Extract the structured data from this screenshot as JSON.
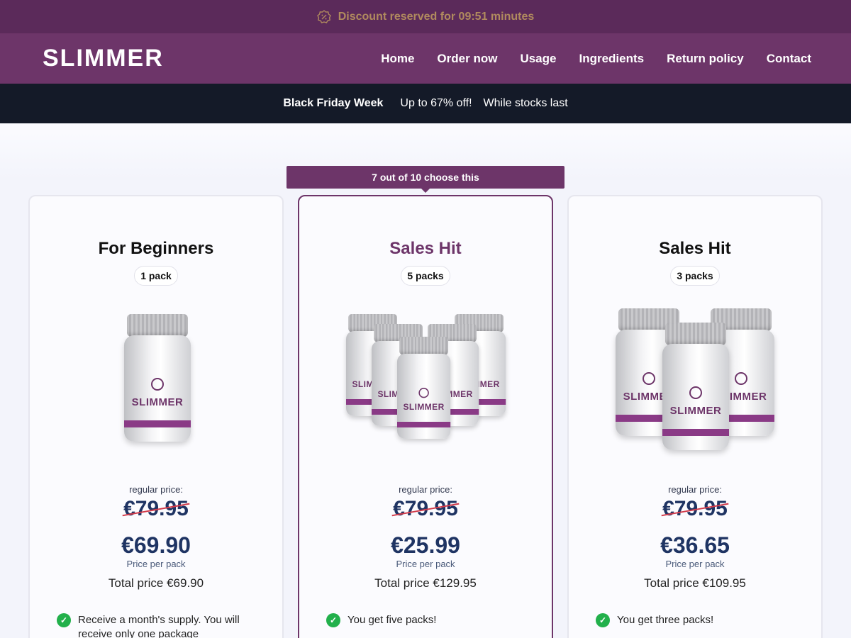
{
  "topbar": {
    "text": "Discount reserved for 09:51 minutes",
    "icon": "discount-badge-icon"
  },
  "nav": {
    "logo": "SLIMMER",
    "items": [
      "Home",
      "Order now",
      "Usage",
      "Ingredients",
      "Return policy",
      "Contact"
    ]
  },
  "promo": {
    "part1": "Black Friday Week",
    "part2": "Up to 67% off!",
    "part3": "While stocks last"
  },
  "ribbon": "7 out of 10 choose this",
  "product_label": "SLIMMER",
  "cards": [
    {
      "title": "For Beginners",
      "packs": "1 pack",
      "regular_label": "regular price:",
      "old_price": "€79.95",
      "price": "€69.90",
      "per_label": "Price per pack",
      "total": "Total price €69.90",
      "features": [
        "Receive a month's supply. You will receive only one package"
      ]
    },
    {
      "title": "Sales Hit",
      "packs": "5 packs",
      "regular_label": "regular price:",
      "old_price": "€79.95",
      "price": "€25.99",
      "per_label": "Price per pack",
      "total": "Total price €129.95",
      "features": [
        "You get five packs!"
      ]
    },
    {
      "title": "Sales Hit",
      "packs": "3 packs",
      "regular_label": "regular price:",
      "old_price": "€79.95",
      "price": "€36.65",
      "per_label": "Price per pack",
      "total": "Total price €109.95",
      "features": [
        "You get three packs!"
      ]
    }
  ],
  "colors": {
    "brand": "#6d3569",
    "topbar": "#5b2a5a",
    "promo_bg": "#141a28",
    "price": "#1f3463",
    "check": "#22b04b"
  }
}
